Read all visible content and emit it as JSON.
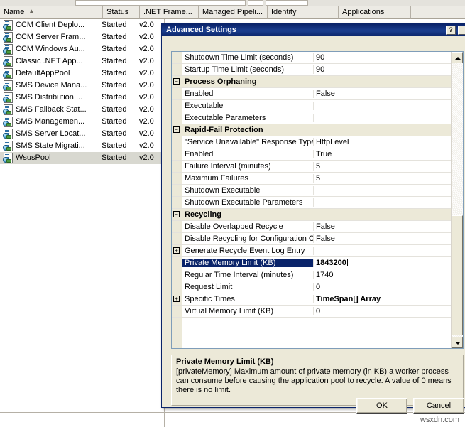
{
  "background": {
    "columns": [
      {
        "label": "Name",
        "sorted": true,
        "sort_glyph": "▲"
      },
      {
        "label": "Status"
      },
      {
        "label": ".NET Frame..."
      },
      {
        "label": "Managed Pipeli..."
      },
      {
        "label": "Identity"
      },
      {
        "label": "Applications"
      }
    ],
    "rows": [
      {
        "name": "CCM Client Deplo...",
        "status": "Started",
        "net": "v2.0",
        "selected": false
      },
      {
        "name": "CCM Server Fram...",
        "status": "Started",
        "net": "v2.0",
        "selected": false
      },
      {
        "name": "CCM Windows Au...",
        "status": "Started",
        "net": "v2.0",
        "selected": false
      },
      {
        "name": "Classic .NET App...",
        "status": "Started",
        "net": "v2.0",
        "selected": false
      },
      {
        "name": "DefaultAppPool",
        "status": "Started",
        "net": "v2.0",
        "selected": false
      },
      {
        "name": "SMS Device Mana...",
        "status": "Started",
        "net": "v2.0",
        "selected": false
      },
      {
        "name": "SMS Distribution ...",
        "status": "Started",
        "net": "v2.0",
        "selected": false
      },
      {
        "name": "SMS Fallback Stat...",
        "status": "Started",
        "net": "v2.0",
        "selected": false
      },
      {
        "name": "SMS Managemen...",
        "status": "Started",
        "net": "v2.0",
        "selected": false
      },
      {
        "name": "SMS Server Locat...",
        "status": "Started",
        "net": "v2.0",
        "selected": false
      },
      {
        "name": "SMS State Migrati...",
        "status": "Started",
        "net": "v2.0",
        "selected": false
      },
      {
        "name": "WsusPool",
        "status": "Started",
        "net": "v2.0",
        "selected": true
      }
    ],
    "watermark": "wsxdn.com"
  },
  "dialog": {
    "title": "Advanced Settings",
    "help_label": "?",
    "close_label": "✕",
    "grid_rows": [
      {
        "kind": "prop",
        "label": "Shutdown Time Limit (seconds)",
        "value": "90"
      },
      {
        "kind": "prop",
        "label": "Startup Time Limit (seconds)",
        "value": "90"
      },
      {
        "kind": "category",
        "label": "Process Orphaning",
        "expander": "−"
      },
      {
        "kind": "prop",
        "label": "Enabled",
        "value": "False"
      },
      {
        "kind": "prop",
        "label": "Executable",
        "value": ""
      },
      {
        "kind": "prop",
        "label": "Executable Parameters",
        "value": ""
      },
      {
        "kind": "category",
        "label": "Rapid-Fail Protection",
        "expander": "−"
      },
      {
        "kind": "prop",
        "label": "\"Service Unavailable\" Response Type",
        "value": "HttpLevel"
      },
      {
        "kind": "prop",
        "label": "Enabled",
        "value": "True"
      },
      {
        "kind": "prop",
        "label": "Failure Interval (minutes)",
        "value": "5"
      },
      {
        "kind": "prop",
        "label": "Maximum Failures",
        "value": "5"
      },
      {
        "kind": "prop",
        "label": "Shutdown Executable",
        "value": ""
      },
      {
        "kind": "prop",
        "label": "Shutdown Executable Parameters",
        "value": ""
      },
      {
        "kind": "category",
        "label": "Recycling",
        "expander": "−"
      },
      {
        "kind": "prop",
        "label": "Disable Overlapped Recycle",
        "value": "False"
      },
      {
        "kind": "prop",
        "label": "Disable Recycling for Configuration Ch",
        "value": "False"
      },
      {
        "kind": "prop",
        "label": "Generate Recycle Event Log Entry",
        "value": "",
        "expander": "+"
      },
      {
        "kind": "prop",
        "label": "Private Memory Limit (KB)",
        "value": "1843200",
        "selected": true,
        "editing": true
      },
      {
        "kind": "prop",
        "label": "Regular Time Interval (minutes)",
        "value": "1740"
      },
      {
        "kind": "prop",
        "label": "Request Limit",
        "value": "0"
      },
      {
        "kind": "prop",
        "label": "Specific Times",
        "value": "TimeSpan[] Array",
        "bold_value": true,
        "expander": "+"
      },
      {
        "kind": "prop",
        "label": "Virtual Memory Limit (KB)",
        "value": "0"
      }
    ],
    "scrollbar": {
      "up_label": "▲",
      "down_label": "▼"
    },
    "description": {
      "title": "Private Memory Limit (KB)",
      "body": "[privateMemory] Maximum amount of private memory (in KB) a worker process can consume before causing the application pool to recycle.  A value of 0 means there is no limit."
    },
    "ok_label": "OK",
    "cancel_label": "Cancel"
  }
}
